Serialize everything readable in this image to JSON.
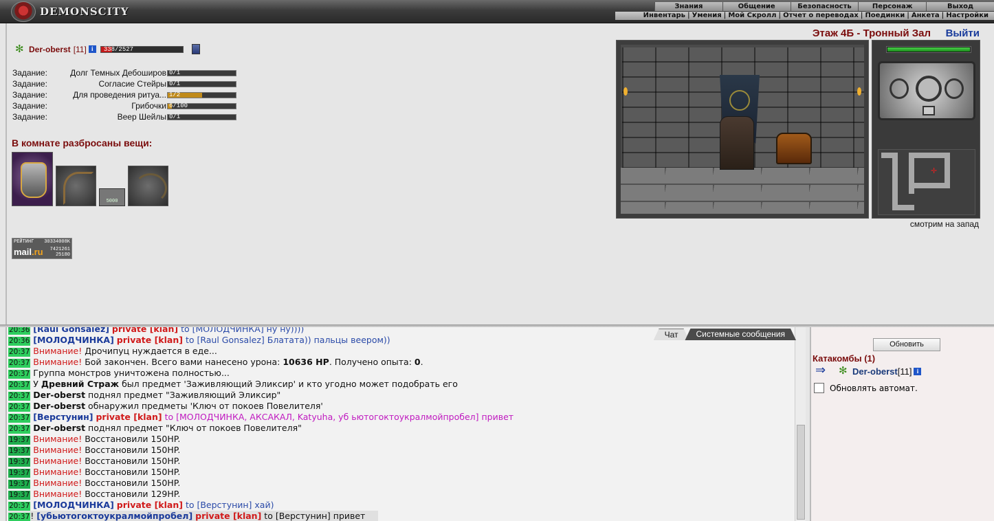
{
  "header": {
    "logo_text": "DEMONSCITY",
    "menu_top": [
      "Знания",
      "Общение",
      "Безопасность",
      "Персонаж",
      "Выход"
    ],
    "menu_bottom": [
      "Инвентарь",
      "Умения",
      "Мой Скролл",
      "Отчет о переводах",
      "Поединки",
      "Анкета",
      "Настройки"
    ]
  },
  "location": {
    "title": "Этаж 4Б - Тронный Зал",
    "exit": "Выйти",
    "facing": "смотрим на запад"
  },
  "player": {
    "name": "Der-oberst",
    "level": "[11]",
    "info": "i",
    "hp_text": "338/2527",
    "hp_ratio": 0.134
  },
  "quests": [
    {
      "label": "Задание:",
      "name": "Долг Темных Дебоширов",
      "value": "0/1",
      "ratio": 0
    },
    {
      "label": "Задание:",
      "name": "Согласие Стейры",
      "value": "0/1",
      "ratio": 0
    },
    {
      "label": "Задание:",
      "name": "Для проведения ритуа...",
      "value": "1/2",
      "ratio": 0.5
    },
    {
      "label": "Задание:",
      "name": "Грибочки",
      "value": "6/100",
      "ratio": 0.06
    },
    {
      "label": "Задание:",
      "name": "Веер Шейлы",
      "value": "0/1",
      "ratio": 0
    }
  ],
  "room_items": {
    "title": "В комнате разбросаны вещи:",
    "money_label": "5000"
  },
  "counter": {
    "title": "РЕЙТИНГ",
    "n1": "30334008K",
    "brand": "mail",
    "brand_suffix": ".ru",
    "n2": "7421261",
    "n3": "25180"
  },
  "minimap": {
    "hp_ratio": 0.98
  },
  "chat": {
    "tabs": [
      "Чат",
      "Системные сообщения"
    ],
    "lines": [
      {
        "ts": "20:36",
        "nick": "[Raul Gonsalez]",
        "priv": "private [klan]",
        "to": "to [МОЛОДЧИНКА] ну ну))))",
        "kind": "pm"
      },
      {
        "ts": "20:36",
        "nick": "[МОЛОДЧИНКА]",
        "priv": "private [klan]",
        "to": "to [Raul Gonsalez] Блатата)) пальцы веером))",
        "kind": "pm"
      },
      {
        "ts": "20:37",
        "warn": "Внимание!",
        "text": "Дрочипуц нуждается в еде...",
        "kind": "warn"
      },
      {
        "ts": "20:37",
        "warn": "Внимание!",
        "text": "Бой закончен. Всего вами нанесено урона:",
        "b1": "10636 HP",
        "text2": ". Получено опыта:",
        "b2": "0",
        "text3": ".",
        "kind": "battle"
      },
      {
        "ts": "20:37",
        "text": "Группа монстров уничтожена полностью...",
        "kind": "plain"
      },
      {
        "ts": "20:37",
        "pre": "У",
        "bold": "Древний Страж",
        "text": "был предмет 'Заживляющий Эликсир' и кто угодно может подобрать его",
        "kind": "boldmid"
      },
      {
        "ts": "20:37",
        "bold": "Der-oberst",
        "text": "поднял предмет \"Заживляющий Эликсир\"",
        "kind": "boldstart"
      },
      {
        "ts": "20:37",
        "bold": "Der-oberst",
        "text": "обнаружил предметы 'Ключ от покоев Повелителя'",
        "kind": "boldstart"
      },
      {
        "ts": "20:37",
        "nick": "[Верстунин]",
        "priv": "private [klan]",
        "to": "to [МОЛОДЧИНКА, АКСАКАЛ, Katyuha, уб ьютогоктоукралмойпробел] привет",
        "kind": "pm_magenta"
      },
      {
        "ts": "20:37",
        "bold": "Der-oberst",
        "text": "поднял предмет \"Ключ от покоев Повелителя\"",
        "kind": "boldstart"
      },
      {
        "ts": "19:37",
        "warn": "Внимание!",
        "text": "Восстановили 150HP.",
        "kind": "warn_old"
      },
      {
        "ts": "19:37",
        "warn": "Внимание!",
        "text": "Восстановили 150HP.",
        "kind": "warn_old"
      },
      {
        "ts": "19:37",
        "warn": "Внимание!",
        "text": "Восстановили 150HP.",
        "kind": "warn_old"
      },
      {
        "ts": "19:37",
        "warn": "Внимание!",
        "text": "Восстановили 150HP.",
        "kind": "warn_old"
      },
      {
        "ts": "19:37",
        "warn": "Внимание!",
        "text": "Восстановили 150HP.",
        "kind": "warn_old"
      },
      {
        "ts": "19:37",
        "warn": "Внимание!",
        "text": "Восстановили 129HP.",
        "kind": "warn_old"
      },
      {
        "ts": "20:37",
        "nick": "[МОЛОДЧИНКА]",
        "priv": "private [klan]",
        "to": "to [Верстунин] хай)",
        "kind": "pm"
      },
      {
        "ts": "20:37",
        "excl": "!",
        "nick": "[убьютогоктоукралмойпробел]",
        "priv": "private [klan]",
        "to": "to [Верстунин] привет",
        "kind": "pm_last"
      }
    ]
  },
  "online": {
    "refresh": "Обновить",
    "room": "Катакомбы (1)",
    "name": "Der-oberst",
    "level": "[11]",
    "info": "i",
    "auto_label": "Обновлять автомат."
  },
  "colors": {
    "title_red": "#7a0c0c",
    "link_blue": "#1a3c9c",
    "timestamp_green": "#2ece5e",
    "warn_red": "#d01a1a"
  }
}
